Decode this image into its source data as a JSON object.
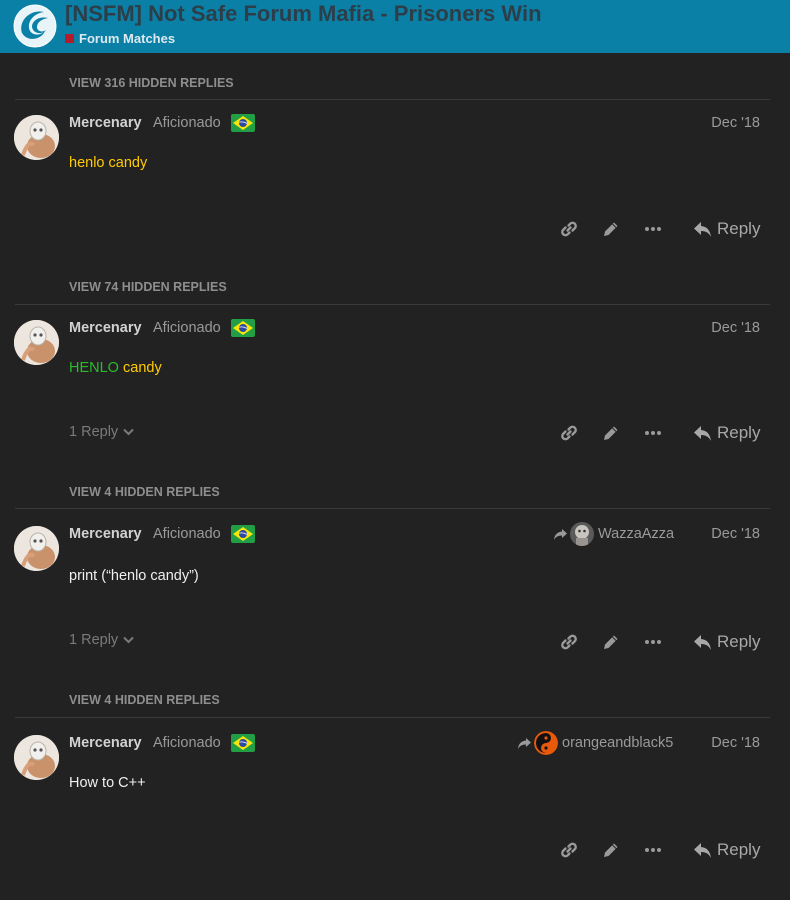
{
  "header": {
    "title": "[NSFM] Not Safe Forum Mafia - Prisoners Win",
    "category": "Forum Matches",
    "accent_color": "#0a80a6",
    "category_color": "#b51c2b",
    "logo_icon": "forum-swirl-logo"
  },
  "posts": [
    {
      "hidden_replies": "VIEW 316 HIDDEN REPLIES",
      "username": "Mercenary",
      "user_title": "Aficionado",
      "flag": "brazil-flag-icon",
      "date": "Dec '18",
      "body_parts": [
        "henlo candy"
      ],
      "replies_label": "",
      "reply_to_user": "",
      "reply_label": "Reply"
    },
    {
      "hidden_replies": "VIEW 74 HIDDEN REPLIES",
      "username": "Mercenary",
      "user_title": "Aficionado",
      "flag": "brazil-flag-icon",
      "date": "Dec '18",
      "body_parts": [
        "HENLO",
        "candy"
      ],
      "replies_label": "1 Reply",
      "reply_to_user": "",
      "reply_label": "Reply"
    },
    {
      "hidden_replies": "VIEW 4 HIDDEN REPLIES",
      "username": "Mercenary",
      "user_title": "Aficionado",
      "flag": "brazil-flag-icon",
      "date": "Dec '18",
      "body_parts": [
        "print (“henlo candy”)"
      ],
      "replies_label": "1 Reply",
      "reply_to_user": "WazzaAzza",
      "reply_label": "Reply"
    },
    {
      "hidden_replies": "VIEW 4 HIDDEN REPLIES",
      "username": "Mercenary",
      "user_title": "Aficionado",
      "flag": "brazil-flag-icon",
      "date": "Dec '18",
      "body_parts": [
        "How to C++"
      ],
      "replies_label": "",
      "reply_to_user": "orangeandblack5",
      "reply_label": "Reply"
    }
  ]
}
